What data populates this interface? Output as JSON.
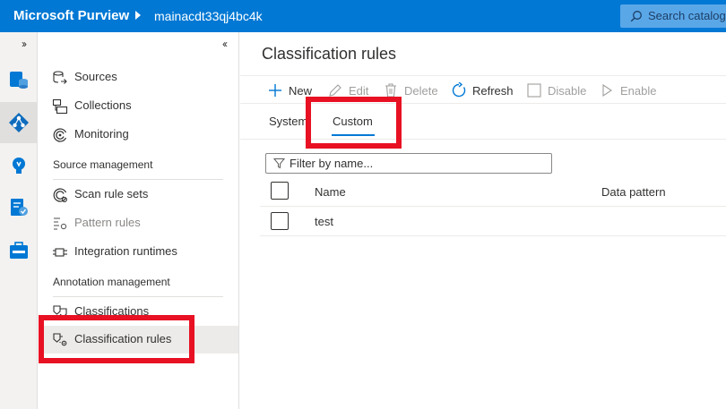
{
  "topbar": {
    "brand": "Microsoft Purview",
    "account": "mainacdt33qj4bc4k",
    "search_placeholder": "Search catalog",
    "background": "#0078d4"
  },
  "rail": {
    "expand_glyph": "››",
    "icons": [
      "data-catalog-icon",
      "data-map-icon",
      "insights-icon",
      "policy-icon",
      "management-icon"
    ]
  },
  "sidebar": {
    "collapse_glyph": "‹‹",
    "items": [
      {
        "label": "Sources",
        "icon": "sources-icon"
      },
      {
        "label": "Collections",
        "icon": "collections-icon"
      },
      {
        "label": "Monitoring",
        "icon": "monitoring-icon"
      }
    ],
    "source_management": {
      "header": "Source management",
      "items": [
        {
          "label": "Scan rule sets",
          "icon": "scan-rule-sets-icon"
        },
        {
          "label": "Pattern rules",
          "icon": "pattern-rules-icon"
        },
        {
          "label": "Integration runtimes",
          "icon": "integration-runtimes-icon"
        }
      ]
    },
    "annotation_management": {
      "header": "Annotation management",
      "items": [
        {
          "label": "Classifications",
          "icon": "classifications-icon"
        },
        {
          "label": "Classification rules",
          "icon": "classification-rules-icon"
        }
      ]
    }
  },
  "main": {
    "title": "Classification rules",
    "toolbar": {
      "new": "New",
      "edit": "Edit",
      "delete": "Delete",
      "refresh": "Refresh",
      "disable": "Disable",
      "enable": "Enable"
    },
    "tabs": {
      "system": "System",
      "custom": "Custom",
      "selected": "Custom"
    },
    "filter_placeholder": "Filter by name...",
    "table": {
      "columns": [
        "Name",
        "Data pattern"
      ],
      "rows": [
        {
          "name": "test",
          "data_pattern": ""
        }
      ]
    }
  },
  "colors": {
    "accent": "#0078d4",
    "highlight": "#e81123"
  }
}
